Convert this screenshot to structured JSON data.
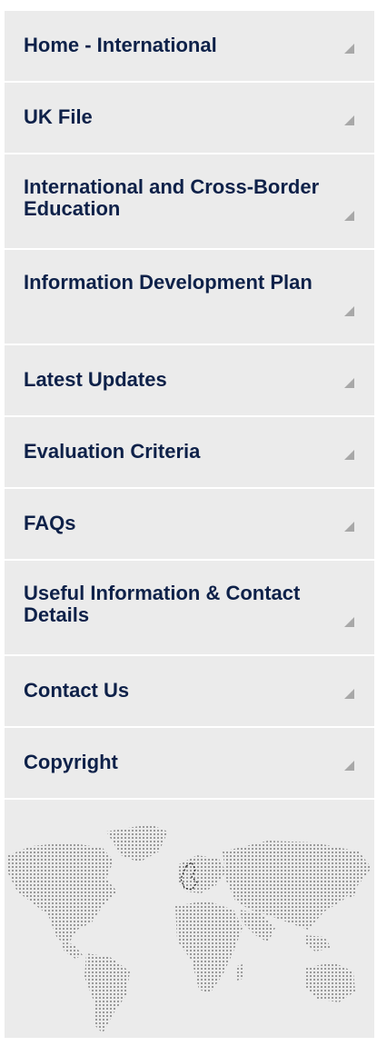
{
  "sidebar": {
    "items": [
      {
        "label": "Home - International",
        "lines": 1
      },
      {
        "label": "UK File",
        "lines": 1
      },
      {
        "label": "International and Cross-Border Education",
        "lines": 2
      },
      {
        "label": "Information Development Plan",
        "lines": 2
      },
      {
        "label": "Latest Updates",
        "lines": 1
      },
      {
        "label": "Evaluation Criteria",
        "lines": 1
      },
      {
        "label": "FAQs",
        "lines": 1
      },
      {
        "label": "Useful Information & Contact Details",
        "lines": 2
      },
      {
        "label": "Contact Us",
        "lines": 1
      },
      {
        "label": "Copyright",
        "lines": 1
      }
    ],
    "arrow_icon": "expand-triangle-icon",
    "map_icon": "world-map-icon",
    "colors": {
      "background": "#ebebeb",
      "text": "#0e2149",
      "divider": "#ffffff",
      "arrow": "#a8a8a8",
      "map_dots": "#9a9a9a"
    }
  }
}
